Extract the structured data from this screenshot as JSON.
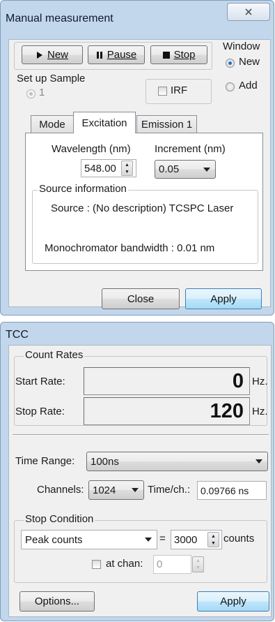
{
  "manual": {
    "title": "Manual measurement",
    "close_icon": "close-icon",
    "toolbar": {
      "new_icon": "play-triangle-icon",
      "new_label": "New",
      "pause_icon": "pause-bars-icon",
      "pause_label": "Pause",
      "stop_icon": "stop-square-icon",
      "stop_label": "Stop"
    },
    "setup_sample": {
      "label": "Set up Sample",
      "option": "1"
    },
    "irf_label": "IRF",
    "window_group": {
      "label": "Window",
      "new_label": "New",
      "add_label": "Add",
      "selected": "New"
    },
    "tabs": [
      {
        "label": "Mode"
      },
      {
        "label": "Excitation",
        "active": true
      },
      {
        "label": "Emission 1"
      }
    ],
    "excitation": {
      "wavelength_label": "Wavelength (nm)",
      "wavelength_value": "548.00",
      "increment_label": "Increment (nm)",
      "increment_value": "0.05",
      "source_group_label": "Source information",
      "source_line": "Source :  (No description) TCSPC Laser",
      "bandwidth_line": "Monochromator bandwidth :  0.01 nm"
    },
    "close_label": "Close",
    "apply_label": "Apply"
  },
  "tcc": {
    "title": "TCC",
    "count_rates": {
      "group_label": "Count Rates",
      "start_label": "Start Rate:",
      "start_value": "0",
      "stop_label": "Stop Rate:",
      "stop_value": "120",
      "unit": "Hz."
    },
    "time_range": {
      "label": "Time Range:",
      "value": "100ns"
    },
    "channels": {
      "label": "Channels:",
      "value": "1024"
    },
    "time_per_channel": {
      "label": "Time/ch.:",
      "value": "0.09766 ns"
    },
    "stop_condition": {
      "group_label": "Stop Condition",
      "mode": "Peak counts",
      "equals": "=",
      "value": "3000",
      "unit": "counts",
      "at_chan_label": "at chan:",
      "at_chan_value": "0"
    },
    "options_label": "Options...",
    "apply_label": "Apply"
  },
  "colors": {
    "window_frame": "#c2d6ec",
    "dialog_face": "#f0f0f0",
    "focus_button": "#bee6fd",
    "radio_selected": "#1f6fd1"
  }
}
